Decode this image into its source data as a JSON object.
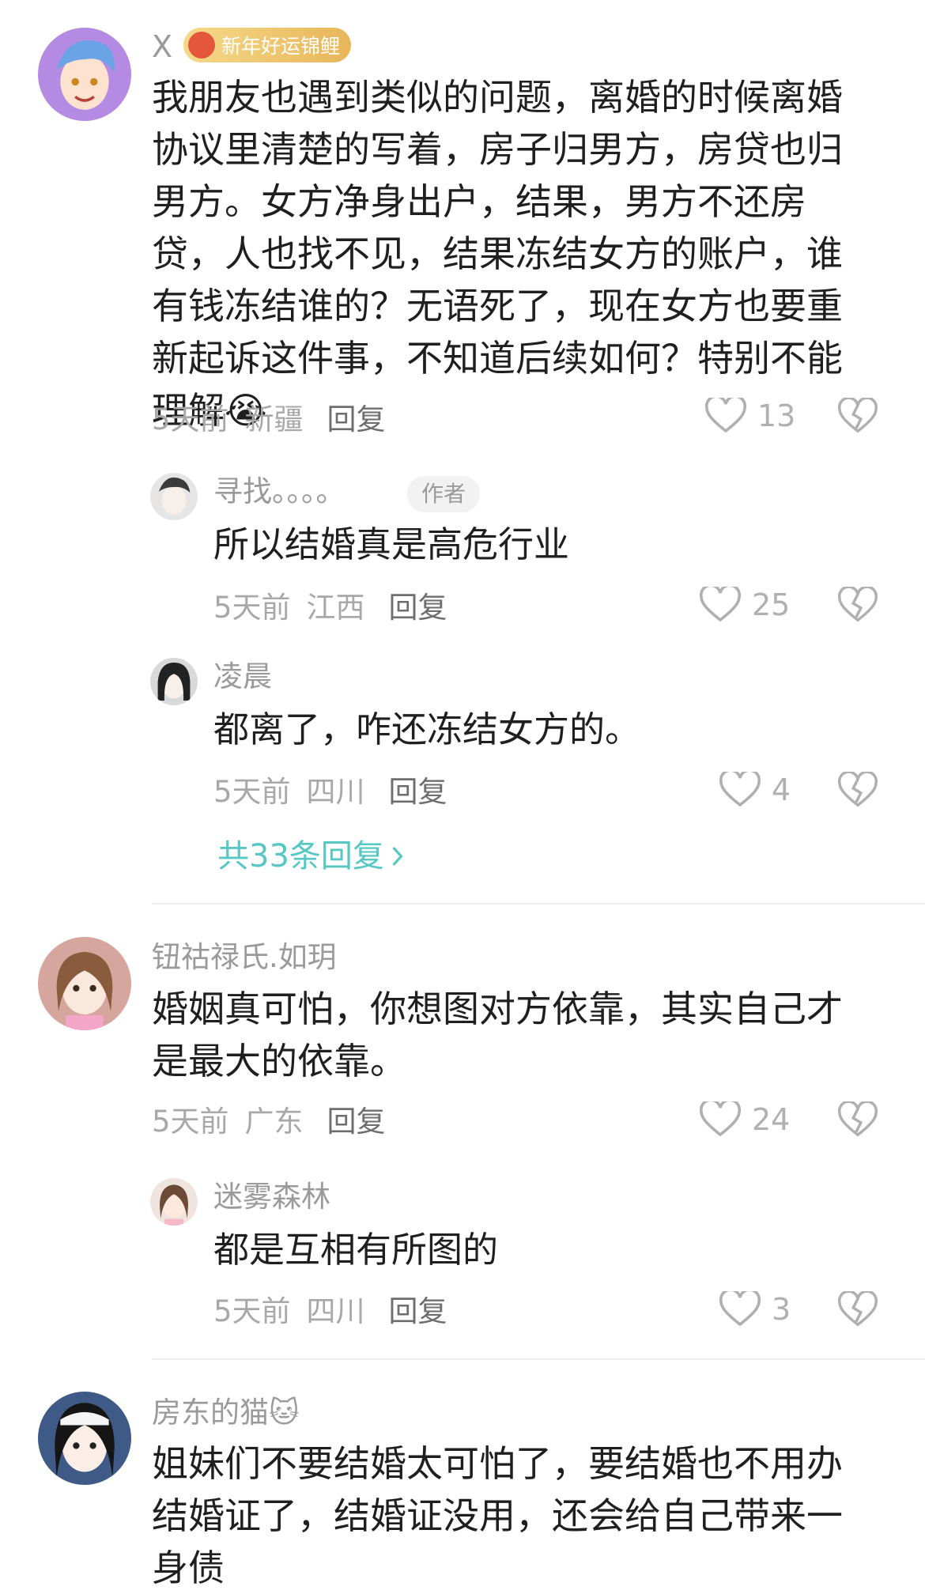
{
  "comments": [
    {
      "username": "X",
      "badge": "新年好运锦鲤",
      "text": "我朋友也遇到类似的问题，离婚的时候离婚协议里清楚的写着，房子归男方，房贷也归男方。女方净身出户，结果，男方不还房贷，人也找不见，结果冻结女方的账户，谁有钱冻结谁的？无语死了，现在女方也要重新起诉这件事，不知道后续如何？特别不能理解",
      "emoji": "😭",
      "time": "5天前",
      "location": "新疆",
      "reply_label": "回复",
      "likes": "13",
      "replies": [
        {
          "username": "寻找。。。。",
          "author_tag": "作者",
          "text": "所以结婚真是高危行业",
          "time": "5天前",
          "location": "江西",
          "reply_label": "回复",
          "likes": "25"
        },
        {
          "username": "凌晨",
          "text": "都离了，咋还冻结女方的。",
          "time": "5天前",
          "location": "四川",
          "reply_label": "回复",
          "likes": "4"
        }
      ],
      "more_replies": "共33条回复"
    },
    {
      "username": "钮祜禄氏.如玥",
      "text": "婚姻真可怕，你想图对方依靠，其实自己才是最大的依靠。",
      "time": "5天前",
      "location": "广东",
      "reply_label": "回复",
      "likes": "24",
      "replies": [
        {
          "username": "迷雾森林",
          "text": "都是互相有所图的",
          "time": "5天前",
          "location": "四川",
          "reply_label": "回复",
          "likes": "3"
        }
      ]
    },
    {
      "username": "房东的猫",
      "username_emoji": "🐱",
      "text": "姐妹们不要结婚太可怕了，要结婚也不用办结婚证了，结婚证没用，还会给自己带来一身债"
    }
  ],
  "icons": {
    "like": "heart-outline-icon",
    "dislike": "broken-heart-icon",
    "more": "chevron-right-icon"
  },
  "colors": {
    "link": "#56c8c3",
    "meta": "#a8a8a8",
    "text": "#1f1f1f"
  }
}
